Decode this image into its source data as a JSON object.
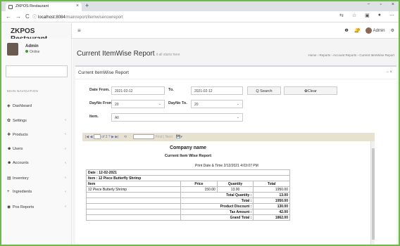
{
  "browser": {
    "tab_title": "ZKPOS Restaurant",
    "url_host": "localhost:8084",
    "url_path": "/mainreport/itemwisenowreport"
  },
  "header": {
    "brand": "ZKPOS Restaurant",
    "user": "Admin"
  },
  "sidebar": {
    "user_name": "Admin",
    "user_status": "Online",
    "nav_header": "MAIN NAVIGATION",
    "items": [
      {
        "label": "Dashboard",
        "icon": "dashboard-icon",
        "glyph": "◈",
        "chev": ""
      },
      {
        "label": "Settings",
        "icon": "gear-icon",
        "glyph": "✿",
        "chev": "‹"
      },
      {
        "label": "Products",
        "icon": "products-icon",
        "glyph": "❖",
        "chev": "‹"
      },
      {
        "label": "Users",
        "icon": "users-icon",
        "glyph": "☻",
        "chev": "‹"
      },
      {
        "label": "Accounts",
        "icon": "accounts-icon",
        "glyph": "☻",
        "chev": "‹"
      },
      {
        "label": "Inventory",
        "icon": "inventory-icon",
        "glyph": "▤",
        "chev": "‹"
      },
      {
        "label": "Ingredients",
        "icon": "plus-icon",
        "glyph": "+",
        "chev": "‹"
      },
      {
        "label": "Pos Reports",
        "icon": "reports-icon",
        "glyph": "◉",
        "chev": "‹"
      }
    ]
  },
  "page": {
    "title": "Current ItemWise Report",
    "subtitle": "it all starts here",
    "breadcrumb": "Home  ›  Reports  ›  Account Reports  ›  Current ItemWise Report"
  },
  "card": {
    "title": "Current ItemWise Report",
    "tools": "−  ×"
  },
  "form": {
    "date_from_label": "Date From.",
    "date_from": "2021-02-12",
    "to_label": "To.",
    "date_to": "2021-02-12",
    "search_label": "Q Search",
    "clear_label": "✿Clear",
    "dayno_from_label": "DayNo From.",
    "dayno_from": "20",
    "dayno_to_label": "DayNo To.",
    "dayno_to": "20",
    "item_label": "Item.",
    "item": "All"
  },
  "viewer": {
    "nav_first": "|◀ ◀",
    "page_of": "of 2 ?",
    "nav_next": "▶ ▶|",
    "refresh": "⟲",
    "find": "Find | Next",
    "export": "💾▾"
  },
  "report": {
    "company": "Company name",
    "subtitle": "Current Item Wise Report",
    "print": "Print Date & Time   2/12/2021 4:03:07 PM",
    "date": "Date : 12-02-2021",
    "item": "Item : 12 Piece Butterfly Shrimp",
    "h_item": "Item",
    "h_price": "Price",
    "h_qty": "Quantity",
    "h_total": "Total",
    "row_item": "12 Piece Butterly Shrimp",
    "row_price": "150.00",
    "row_qty": "13.00",
    "row_total": "1950.00",
    "tq_label": "Total Quantity :",
    "tq": "13.00",
    "t_label": "Total :",
    "t": "1950.00",
    "pd_label": "Product Discount :",
    "pd": "130.00",
    "tax_label": "Tax Amount :",
    "tax": "42.00",
    "gt_label": "Grand Total :",
    "gt": "1862.00"
  }
}
